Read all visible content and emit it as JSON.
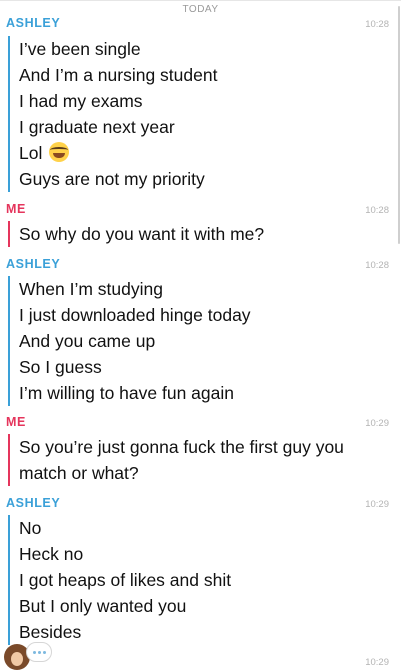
{
  "header": {
    "day_label": "TODAY"
  },
  "messages": [
    {
      "sender": "ASHLEY",
      "time": "10:28",
      "lines": [
        "I’ve been single",
        "And I’m a nursing student",
        "I had my exams",
        "I graduate next year",
        "Lol",
        "Guys are not my priority"
      ]
    },
    {
      "sender": "ME",
      "time": "10:28",
      "lines": [
        "So why do you want it with me?"
      ]
    },
    {
      "sender": "ASHLEY",
      "time": "10:28",
      "lines": [
        "When I’m studying",
        "I just downloaded hinge today",
        "And you came up",
        "So I guess",
        "I’m willing to have fun again"
      ]
    },
    {
      "sender": "ME",
      "time": "10:29",
      "lines": [
        "So you’re just gonna fuck the first guy you match or what?"
      ]
    },
    {
      "sender": "ASHLEY",
      "time": "10:29",
      "lines": [
        "No",
        "Heck no",
        "I got heaps of likes and shit",
        "But I only wanted you",
        "Besides"
      ]
    }
  ],
  "footer": {
    "time": "10:29"
  },
  "colors": {
    "ashley": "#3aa0d8",
    "me": "#e5355c"
  },
  "icons": {
    "laugh_emoji": "face-with-tears-of-joy-icon",
    "avatar": "bitmoji-avatar",
    "typing": "typing-bubble-icon"
  }
}
